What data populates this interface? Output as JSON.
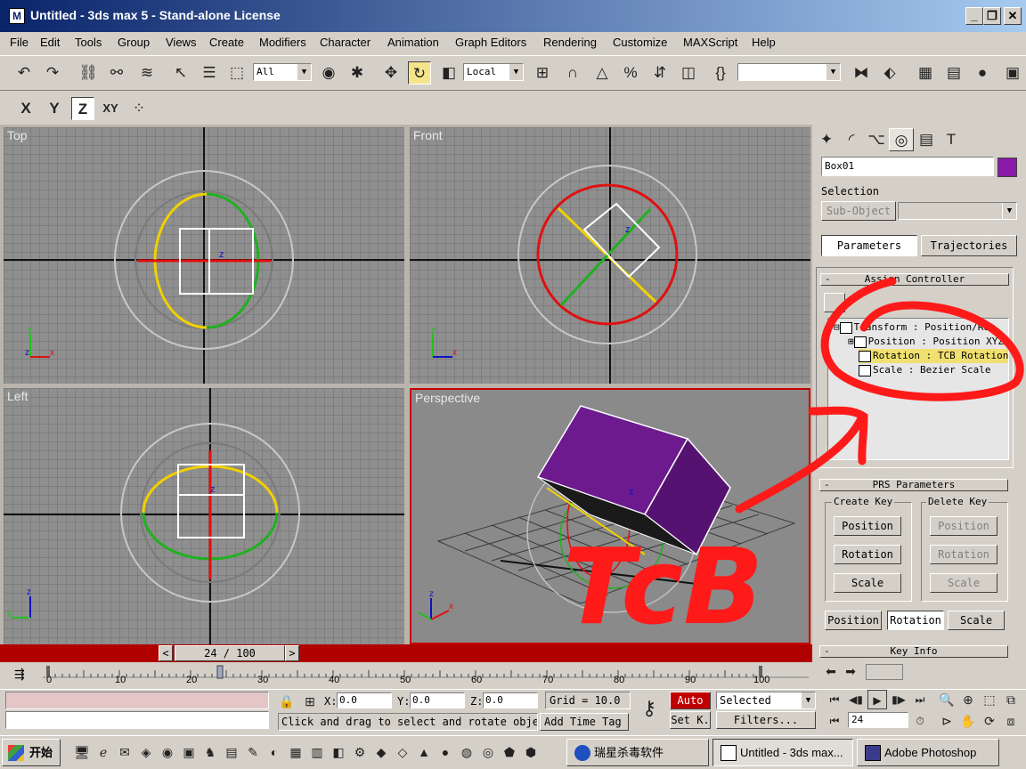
{
  "window": {
    "title": "Untitled - 3ds max 5 - Stand-alone License",
    "minimize": "_",
    "restore": "❐",
    "close": "✕"
  },
  "menu": [
    "File",
    "Edit",
    "Tools",
    "Group",
    "Views",
    "Create",
    "Modifiers",
    "Character",
    "Animation",
    "Graph Editors",
    "Rendering",
    "Customize",
    "MAXScript",
    "Help"
  ],
  "toolbar": {
    "selection_filter": "All",
    "ref_coord": "Local",
    "named_selection": ""
  },
  "axis_constraints": [
    "X",
    "Y",
    "Z",
    "XY"
  ],
  "viewports": {
    "top": "Top",
    "front": "Front",
    "left": "Left",
    "perspective": "Perspective"
  },
  "gizmo_label": "z",
  "axis_labels": {
    "x": "x",
    "y": "y",
    "z": "z"
  },
  "timeslider": {
    "value": "24 / 100",
    "prev": "<",
    "next": ">"
  },
  "track_ticks": [
    "0",
    "10",
    "20",
    "30",
    "40",
    "50",
    "60",
    "70",
    "80",
    "90",
    "100"
  ],
  "command_panel": {
    "object_name": "Box01",
    "object_color": "#8a1aa8",
    "selection_label": "Selection",
    "sub_object": "Sub-Object",
    "tabs": {
      "parameters": "Parameters",
      "trajectories": "Trajectories"
    },
    "assign_controller": "Assign Controller",
    "minus": "-",
    "tree": [
      {
        "text": "Transform : Position/Rot"
      },
      {
        "text": "Position : Position XYZ"
      },
      {
        "text": "Rotation : TCB Rotation",
        "selected": true
      },
      {
        "text": "Scale : Bezier Scale"
      }
    ],
    "prs_parameters": "PRS Parameters",
    "create_key": "Create Key",
    "delete_key": "Delete Key",
    "create_buttons": [
      "Position",
      "Rotation",
      "Scale"
    ],
    "delete_buttons": [
      "Position",
      "Rotation",
      "Scale"
    ],
    "bottom_tabs": [
      "Position",
      "Rotation",
      "Scale"
    ],
    "key_info": "Key Info"
  },
  "annotation": {
    "text": "TcB",
    "color": "#ff1a1a"
  },
  "status": {
    "x_label": "X:",
    "x_value": "0.0",
    "y_label": "Y:",
    "y_value": "0.0",
    "z_label": "Z:",
    "z_value": "0.0",
    "grid": "Grid = 10.0",
    "auto": "Auto",
    "set_key": "Set K.",
    "selected": "Selected",
    "filters": "Filters...",
    "frame": "24",
    "prompt": "Click and drag to select and rotate objec",
    "add_time_tag": "Add Time Tag"
  },
  "taskbar": {
    "start": "开始",
    "tasks": [
      "瑞星杀毒软件",
      "Untitled - 3ds max...",
      "Adobe Photoshop"
    ]
  }
}
